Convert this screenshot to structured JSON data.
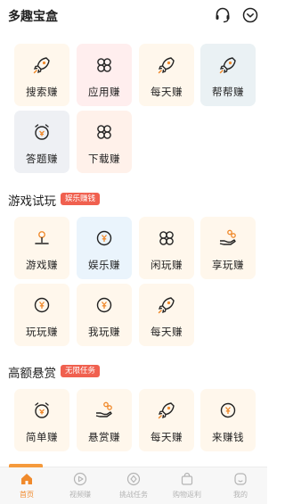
{
  "header": {
    "title": "多趣宝盒",
    "support_icon": "headset-icon",
    "more_icon": "chevron-down-circle-icon"
  },
  "treasure_box": {
    "items": [
      {
        "label": "搜索赚",
        "icon": "rocket-icon"
      },
      {
        "label": "应用赚",
        "icon": "clover-icon"
      },
      {
        "label": "每天赚",
        "icon": "rocket-icon"
      },
      {
        "label": "帮帮赚",
        "icon": "rocket-icon"
      },
      {
        "label": "答题赚",
        "icon": "alarm-clock-icon"
      },
      {
        "label": "下载赚",
        "icon": "clover-icon"
      }
    ]
  },
  "game_section": {
    "title": "游戏试玩",
    "badge": "娱乐赚钱",
    "items": [
      {
        "label": "游戏赚",
        "icon": "joystick-icon"
      },
      {
        "label": "娱乐赚",
        "icon": "yuan-coin-icon"
      },
      {
        "label": "闲玩赚",
        "icon": "clover-icon"
      },
      {
        "label": "享玩赚",
        "icon": "hand-coins-icon"
      },
      {
        "label": "玩玩赚",
        "icon": "yuan-coin-icon"
      },
      {
        "label": "我玩赚",
        "icon": "yuan-coin-icon"
      },
      {
        "label": "每天赚",
        "icon": "rocket-icon"
      }
    ]
  },
  "reward_section": {
    "title": "高额悬赏",
    "badge": "无限任务",
    "items": [
      {
        "label": "简单赚",
        "icon": "alarm-clock-icon"
      },
      {
        "label": "悬赏赚",
        "icon": "hand-coins-icon"
      },
      {
        "label": "每天赚",
        "icon": "rocket-icon"
      },
      {
        "label": "来赚钱",
        "icon": "yuan-coin-icon"
      }
    ]
  },
  "tabbar": {
    "tabs": [
      {
        "label": "首页",
        "icon": "home-icon",
        "active": true
      },
      {
        "label": "视频赚",
        "icon": "play-circle-icon",
        "active": false
      },
      {
        "label": "挑战任务",
        "icon": "diamond-icon",
        "active": false
      },
      {
        "label": "购物返利",
        "icon": "shopping-bag-icon",
        "active": false
      },
      {
        "label": "我的",
        "icon": "profile-icon",
        "active": false
      }
    ]
  },
  "colors": {
    "accent": "#f08a2c",
    "badge": "#f0604f",
    "tile_warm": "#fff7ec",
    "tile_pink": "#ffeeee",
    "tile_blue": "#eaf4fc",
    "tile_gray": "#eef0f4"
  }
}
